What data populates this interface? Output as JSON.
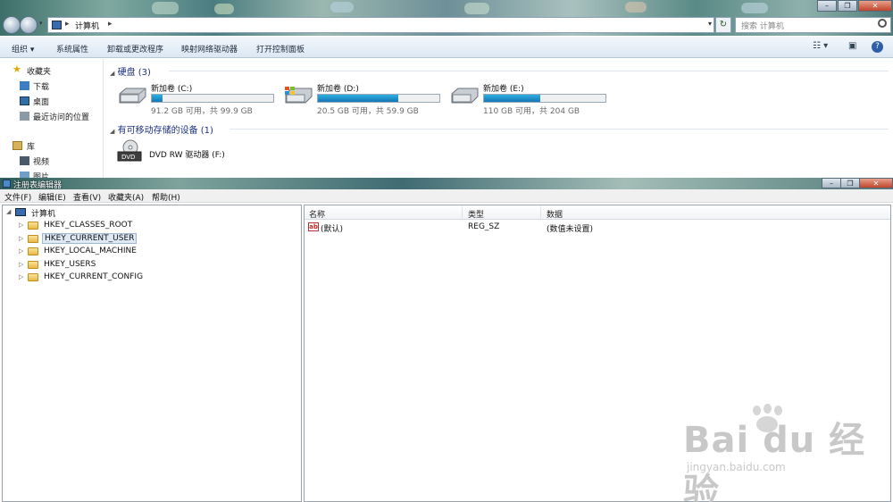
{
  "explorer": {
    "address": {
      "path": "计算机",
      "search_placeholder": "搜索 计算机"
    },
    "toolbar": [
      "组织 ▾",
      "系统属性",
      "卸载或更改程序",
      "映射网络驱动器",
      "打开控制面板"
    ],
    "nav": {
      "favorites": "收藏夹",
      "fav_items": [
        "下载",
        "桌面",
        "最近访问的位置"
      ],
      "library": "库",
      "lib_items": [
        "视频",
        "图片"
      ]
    },
    "groups": {
      "hdd": "硬盘 (3)",
      "removable": "有可移动存储的设备 (1)"
    },
    "drives": [
      {
        "name": "新加卷 (C:)",
        "info": "91.2 GB 可用，共 99.9 GB",
        "used_fraction": 0.09
      },
      {
        "name": "新加卷 (D:)",
        "info": "20.5 GB 可用，共 59.9 GB",
        "used_fraction": 0.66
      },
      {
        "name": "新加卷 (E:)",
        "info": "110 GB 可用，共 204 GB",
        "used_fraction": 0.46
      }
    ],
    "dvd": {
      "name": "DVD RW 驱动器 (F:)"
    }
  },
  "regedit": {
    "title": "注册表编辑器",
    "menu": [
      "文件(F)",
      "编辑(E)",
      "查看(V)",
      "收藏夹(A)",
      "帮助(H)"
    ],
    "tree": {
      "root": "计算机",
      "keys": [
        "HKEY_CLASSES_ROOT",
        "HKEY_CURRENT_USER",
        "HKEY_LOCAL_MACHINE",
        "HKEY_USERS",
        "HKEY_CURRENT_CONFIG"
      ],
      "selected_index": 1
    },
    "columns": [
      "名称",
      "类型",
      "数据"
    ],
    "rows": [
      {
        "name": "(默认)",
        "type": "REG_SZ",
        "data": "(数值未设置)"
      }
    ]
  },
  "watermark": {
    "brand": "Bai du 经验",
    "url": "jingyan.baidu.com"
  },
  "colors": {
    "bar_fill": "#1f8fcc",
    "group_heading": "#1e3287",
    "selection": "#dfe9f5"
  }
}
